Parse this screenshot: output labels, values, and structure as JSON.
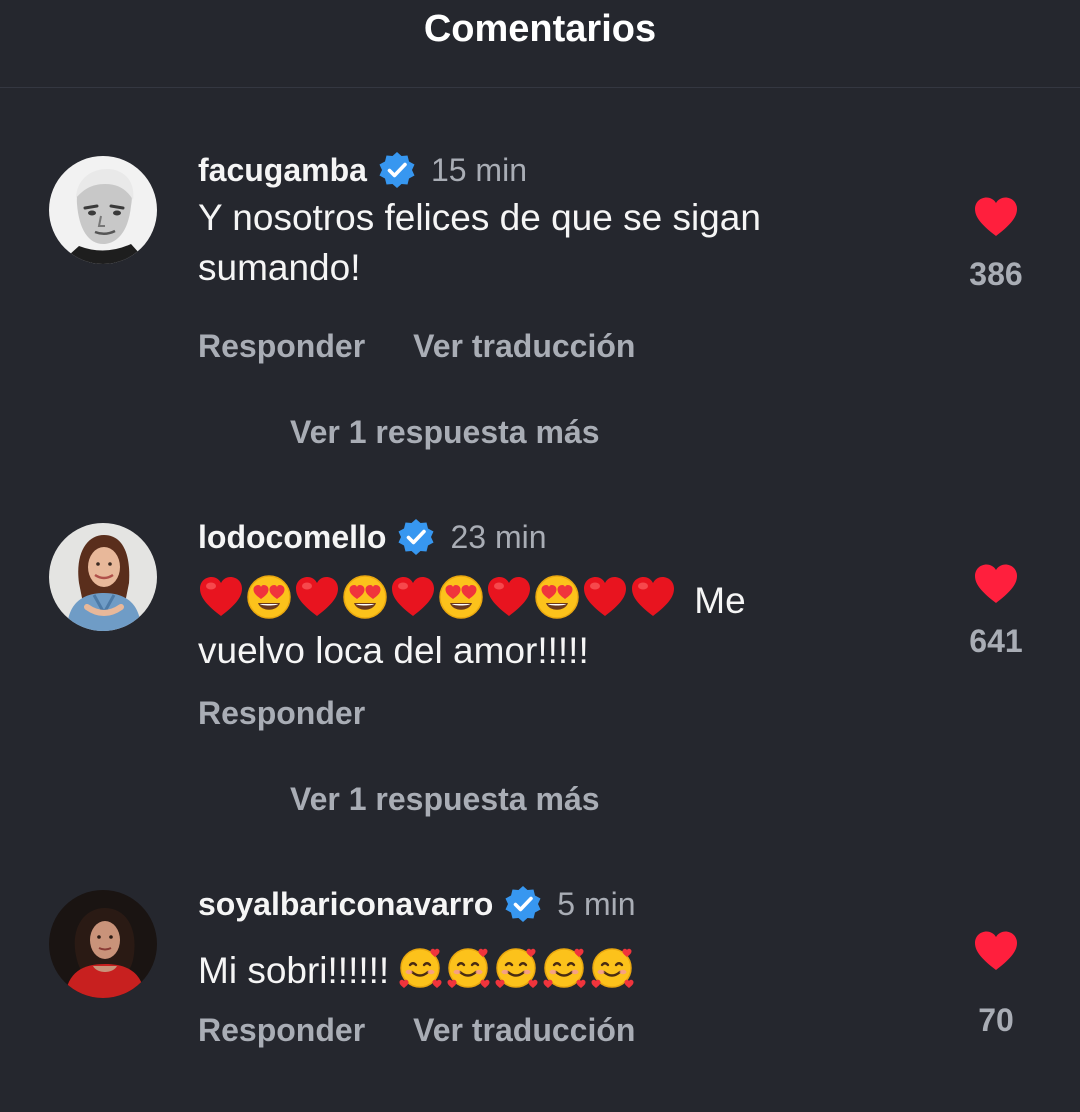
{
  "header": {
    "title": "Comentarios"
  },
  "comments": [
    {
      "username": "facugamba",
      "time": "15 min",
      "text_line1": "Y nosotros felices de que se sigan",
      "text_line2": "sumando!",
      "likes": "386",
      "reply_label": "Responder",
      "translate_label": "Ver traducción",
      "more_replies": "Ver 1 respuesta más"
    },
    {
      "username": "lodocomello",
      "time": "23 min",
      "text_line1_suffix": "Me",
      "text_line2": "vuelvo loca del amor!!!!!",
      "emoji_sequence": [
        "red-heart",
        "heart-eyes",
        "red-heart",
        "heart-eyes",
        "red-heart",
        "heart-eyes",
        "red-heart",
        "heart-eyes",
        "red-heart",
        "red-heart"
      ],
      "likes": "641",
      "reply_label": "Responder",
      "more_replies": "Ver 1 respuesta más"
    },
    {
      "username": "soyalbariconavarro",
      "time": "5 min",
      "text_prefix": "Mi sobri!!!!!!",
      "emoji_sequence": [
        "smiling-face-with-hearts",
        "smiling-face-with-hearts",
        "smiling-face-with-hearts",
        "smiling-face-with-hearts",
        "smiling-face-with-hearts"
      ],
      "likes": "70",
      "reply_label": "Responder",
      "translate_label": "Ver traducción"
    }
  ],
  "colors": {
    "background": "#25272e",
    "heart": "#ff1f3d",
    "verified": "#3797f0",
    "secondary_text": "#a9adb5"
  }
}
